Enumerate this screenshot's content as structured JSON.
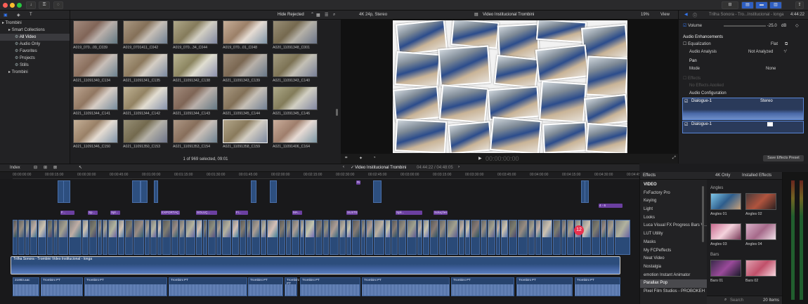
{
  "toolbar": {
    "buttons": [
      "download-icon",
      "key-icon",
      "check-icon"
    ]
  },
  "library": {
    "name": "Trombini",
    "items": [
      {
        "label": "Trombini",
        "level": 0
      },
      {
        "label": "Smart Collections",
        "level": 1
      },
      {
        "label": "All Video",
        "level": 2,
        "selected": true
      },
      {
        "label": "Audio Only",
        "level": 2
      },
      {
        "label": "Favorites",
        "level": 2
      },
      {
        "label": "Projects",
        "level": 2
      },
      {
        "label": "Stills",
        "level": 2
      },
      {
        "label": "Trombini",
        "level": 1
      }
    ]
  },
  "browser": {
    "filter": "Hide Rejected",
    "status": "1 of 969 selected, 09:01",
    "clips": [
      "A019_070...09_C039",
      "A019_0701411_C042",
      "A019_070...34_C044",
      "A019_070...01_C048",
      "A020_11091348_C001",
      "A021_11091340_C134",
      "A021_11091341_C135",
      "A021_11091342_C138",
      "A021_11091343_C139",
      "A021_11091343_C140",
      "A021_11091344_C141",
      "A021_11091344_C142",
      "A021_11091344_C143",
      "A021_11091345_C144",
      "A021_11091345_C146",
      "A021_11091346_C150",
      "A021_11091350_C153",
      "A021_11091353_C154",
      "A021_11091358_C159",
      "A021_11091406_C164"
    ],
    "selected_index": 18
  },
  "viewer": {
    "format": "4K 24p, Stereo",
    "title": "Video Institucional Trombini",
    "zoom": "19%",
    "view_label": "View",
    "timecode": "00:00:00:00"
  },
  "inspector": {
    "title": "Trilha Sonora - Tro...Institucional - longa",
    "duration": "4:44:22",
    "volume_label": "Volume",
    "volume_value": "-25.0",
    "volume_unit": "dB",
    "audio_enhancements": "Audio Enhancements",
    "equalization_label": "Equalization",
    "equalization_value": "Flat",
    "analysis_label": "Audio Analysis",
    "analysis_value": "Not Analyzed",
    "pan_label": "Pan",
    "mode_label": "Mode",
    "mode_value": "None",
    "effects_label": "Effects",
    "no_effects": "No Effects Applied",
    "config_label": "Audio Configuration",
    "channel1": "Dialogue-1",
    "channel1_mode": "Stereo",
    "channel2": "Dialogue-1",
    "save_preset": "Save Effects Preset"
  },
  "timeline": {
    "index_label": "Index",
    "project": "Video Institucional Trombini",
    "timecode": "04:44:22 / 04:48:05",
    "ruler": [
      "00:00:00:00",
      "00:00:15:00",
      "00:00:30:00",
      "00:00:45:00",
      "00:01:00:00",
      "00:01:15:00",
      "00:01:30:00",
      "00:01:45:00",
      "00:02:00:00",
      "00:02:15:00",
      "00:02:30:00",
      "00:02:45:00",
      "00:03:00:00",
      "00:03:15:00",
      "00:03:30:00",
      "00:03:45:00",
      "00:04:00:00",
      "00:04:15:00",
      "00:04:30:00",
      "00:04:45:00"
    ],
    "titles": [
      {
        "label": "F...",
        "row": 0
      },
      {
        "label": "Sp...",
        "row": 0
      },
      {
        "label": "Spl...",
        "row": 0
      },
      {
        "label": "EXPORTAÇ...",
        "row": 0
      },
      {
        "label": "SOLUÇ...",
        "row": 0
      },
      {
        "label": "Fi...",
        "row": 0
      },
      {
        "label": "MA...",
        "row": 0
      },
      {
        "label": "SUSTENTABIL...",
        "row": 0
      },
      {
        "label": "Spli...",
        "row": 0
      },
      {
        "label": "Soluções e",
        "row": 0
      },
      {
        "label": "4 - 6",
        "row": 1
      },
      {
        "label": "Ro...",
        "row": 2
      }
    ],
    "music_label": "Trilha Sonora - Trombini Video Institucional - longa",
    "dialogue_first": "21883.aac",
    "dialogue_label": "Trombini PT",
    "badge": "12"
  },
  "effects": {
    "header": "Effects",
    "filter": "4K Only",
    "installed": "Installed Effects",
    "categories": [
      "VIDEO",
      "FxFactory Pro",
      "Keying",
      "Light",
      "Looks",
      "Luca Visual FX Progress Bars V...",
      "LUT Utility",
      "Masks",
      "My FCPeffects",
      "Neat Video",
      "Nostalgia",
      "emotion Instant Animator",
      "Parallax Pop",
      "Pixel Film Studios - PROBOKEH"
    ],
    "selected": "Parallax Pop",
    "group1": "Angles",
    "tiles": [
      "Angles 01",
      "Angles 02",
      "Angles 03",
      "Angles 04"
    ],
    "group2": "Bars",
    "tiles2": [
      "Bars 01",
      "Bars 02"
    ],
    "search_placeholder": "Search",
    "count": "20 Items"
  },
  "colors": {
    "accent": "#3478f6",
    "title_clip": "#6b3fa0",
    "clip_blue": "#2a4a78",
    "selection": "#f0f0f0"
  }
}
